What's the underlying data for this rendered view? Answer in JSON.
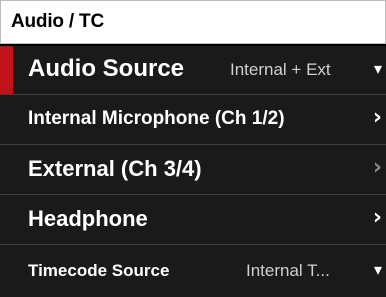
{
  "header": {
    "title": "Audio / TC"
  },
  "menu": {
    "items": [
      {
        "label": "Audio Source",
        "value": "Internal + Ext",
        "arrow": "▾",
        "selected": true
      },
      {
        "label": "Internal Microphone (Ch 1/2)",
        "value": "",
        "arrow": "›",
        "selected": false
      },
      {
        "label": "External (Ch 3/4)",
        "value": "",
        "arrow": "›",
        "selected": false
      },
      {
        "label": "Headphone",
        "value": "",
        "arrow": "›",
        "selected": false
      },
      {
        "label": "Timecode Source",
        "value": "Internal T...",
        "arrow": "▾",
        "selected": false
      }
    ]
  },
  "colors": {
    "background": "#000000",
    "row_background": "#1a1a1a",
    "selection_accent": "#c1121c",
    "header_background": "#ffffff"
  },
  "icons": {
    "dropdown": "chevron-down-icon",
    "submenu": "chevron-right-icon"
  }
}
